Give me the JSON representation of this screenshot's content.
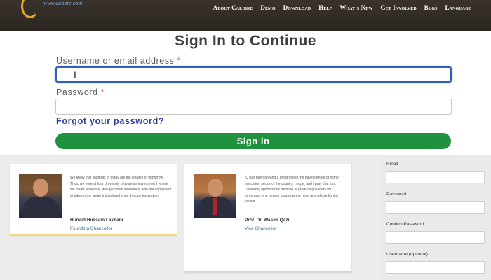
{
  "header": {
    "logo_text": "www.calibre.com",
    "nav": [
      "About Calibre",
      "Demo",
      "Download",
      "Help",
      "What's New",
      "Get Involved",
      "Bugs",
      "Language"
    ]
  },
  "signin": {
    "title": "Sign In to Continue",
    "username_label": "Username or email address",
    "username_value": "I",
    "password_label": "Password",
    "required_mark": "*",
    "forgot": "Forgot your password?",
    "submit": "Sign in"
  },
  "cards": [
    {
      "quote": "We know that students of today are the leaders of tomorrow. Thus, we here at Iqra University provide an environment where we foster resilience, well-groomed individuals who are competent to take on the larger institutional ends through innovation.",
      "name": "Hunaid Hussain Lakhani",
      "role": "Founding Chancellor"
    },
    {
      "quote": "IU has been playing a great role in the development of higher education sector of the country. I hope, and I pray that Iqra University upholds this tradition of producing leaders for tomorrow, who govern tomorrow the most and whose light is known.",
      "name": "Prof. Dr. Wasim Qazi",
      "role": "Vice Chancellor"
    }
  ],
  "register": {
    "email_label": "Email",
    "password_label": "Password",
    "confirm_label": "Confirm Password",
    "username_label": "Username (optional)"
  }
}
